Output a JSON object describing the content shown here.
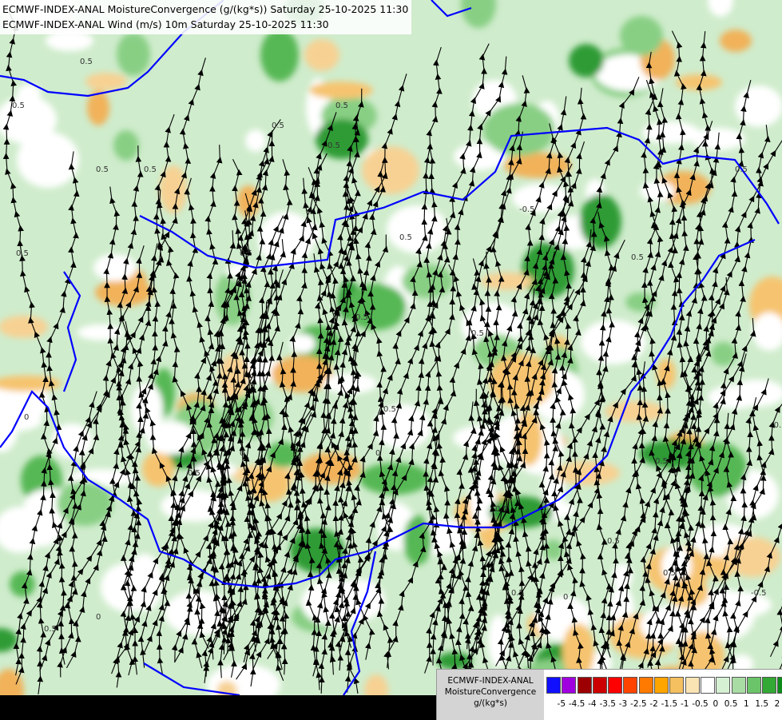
{
  "title": {
    "line1": "ECMWF-INDEX-ANAL MoistureConvergence (g/(kg*s)) Saturday 25-10-2025 11:30",
    "line2": "ECMWF-INDEX-ANAL Wind (m/s) 10m Saturday 25-10-2025 11:30"
  },
  "legend": {
    "line1": "ECMWF-INDEX-ANAL",
    "line2": "MoistureConvergence",
    "unit": "g/(kg*s)",
    "colors": [
      "#1010ff",
      "#a000e0",
      "#9c0000",
      "#cc0000",
      "#ff0000",
      "#ff4400",
      "#ff7a00",
      "#ffa500",
      "#f5c060",
      "#fbe4b4",
      "#ffffff",
      "#d6f0d4",
      "#a8dca4",
      "#6cc46a",
      "#34a834",
      "#0e8c1a"
    ],
    "ticks": [
      "-5",
      "-4.5",
      "-4",
      "-3.5",
      "-3",
      "-2.5",
      "-2",
      "-1.5",
      "-1",
      "-0.5",
      "0",
      "0.5",
      "1",
      "1.5",
      "2"
    ]
  },
  "map": {
    "contour_labels": [
      "0.5",
      "-0.5",
      "0"
    ],
    "border_color": "#0000ff",
    "river_color": "#3a5fd8",
    "streamline_color": "#000000"
  }
}
